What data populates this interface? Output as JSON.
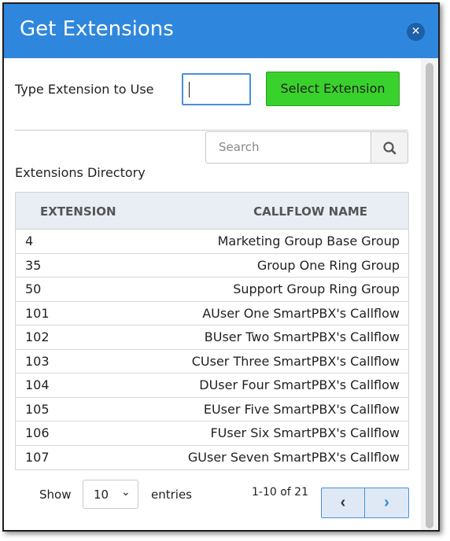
{
  "dialog": {
    "title": "Get Extensions"
  },
  "form": {
    "type_label": "Type Extension to Use",
    "extension_value": "",
    "select_button": "Select Extension"
  },
  "search": {
    "placeholder": "Search"
  },
  "directory": {
    "label": "Extensions Directory",
    "columns": [
      "EXTENSION",
      "CALLFLOW NAME"
    ],
    "rows": [
      {
        "extension": "4",
        "callflow": "Marketing Group Base Group"
      },
      {
        "extension": "35",
        "callflow": "Group One Ring Group"
      },
      {
        "extension": "50",
        "callflow": "Support Group Ring Group"
      },
      {
        "extension": "101",
        "callflow": "AUser One SmartPBX's Callflow"
      },
      {
        "extension": "102",
        "callflow": "BUser Two SmartPBX's Callflow"
      },
      {
        "extension": "103",
        "callflow": "CUser Three SmartPBX's Callflow"
      },
      {
        "extension": "104",
        "callflow": "DUser Four SmartPBX's Callflow"
      },
      {
        "extension": "105",
        "callflow": "EUser Five SmartPBX's Callflow"
      },
      {
        "extension": "106",
        "callflow": "FUser Six SmartPBX's Callflow"
      },
      {
        "extension": "107",
        "callflow": "GUser Seven SmartPBX's Callflow"
      }
    ]
  },
  "footer": {
    "show_label": "Show",
    "entries_value": "10",
    "entries_label": "entries",
    "page_info": "1-10 of 21"
  },
  "colors": {
    "header": "#2f87dd",
    "select_button": "#39d12c",
    "table_header": "#e9edf4"
  }
}
